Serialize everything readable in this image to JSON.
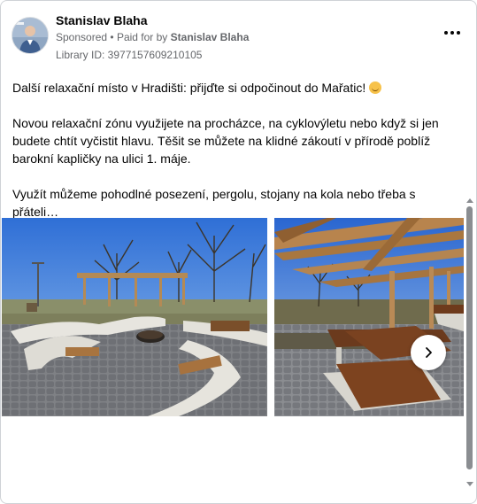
{
  "post": {
    "author": "Stanislav Blaha",
    "sponsored": "Sponsored",
    "paid_for_prefix": "Paid for by",
    "paid_for_by": "Stanislav Blaha",
    "library_id": "Library ID: 3977157609210105",
    "paragraphs": [
      "Další relaxační místo v Hradišti: přijďte si odpočinout do Mařatic!",
      "Novou relaxační zónu využijete na procházce, na cyklovýletu nebo když si jen budete chtít vyčistit hlavu. Těšit se můžete na klidné zákoutí v přírodě poblíž barokní kapličky na ulici 1. máje.",
      "Využít můžeme pohodlné posezení, pergolu, stojany na kola nebo třeba s přáteli…"
    ],
    "separator": "•"
  },
  "icons": {
    "more": "more-horizontal-icon",
    "next": "chevron-right-icon",
    "emoji": "smiling-face-icon"
  },
  "colors": {
    "text_primary": "#050505",
    "text_secondary": "#65676b",
    "border": "#cfd2d6"
  }
}
